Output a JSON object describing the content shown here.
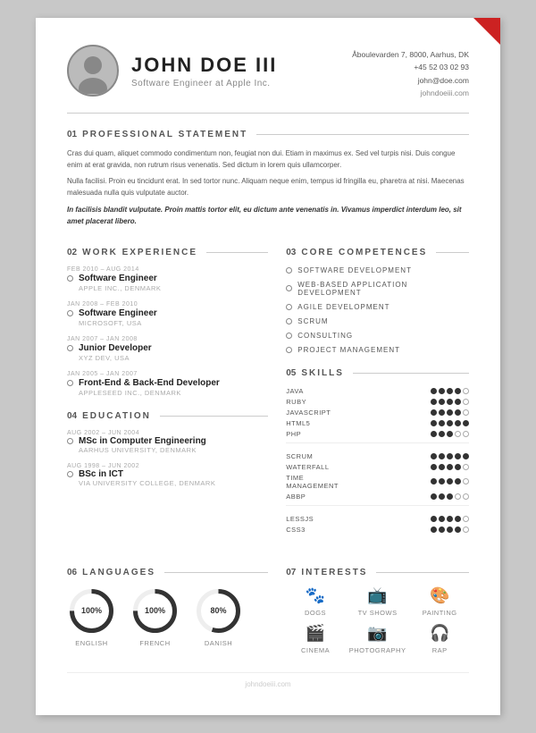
{
  "header": {
    "name": "JOHN DOE III",
    "subtitle": "Software Engineer at Apple Inc.",
    "address": "Åboulevarden 7, 8000, Aarhus, DK",
    "phone": "+45 52 03 02 93",
    "email": "john@doe.com",
    "website": "johndoeiii.com"
  },
  "sections": {
    "professional_statement": {
      "num": "01",
      "label": "PROFESSIONAL STATEMENT",
      "paragraphs": [
        "Cras dui quam, aliquet commodo condimentum non, feugiat non dui. Etiam in maximus ex. Sed vel turpis nisi. Duis congue enim at erat gravida, non rutrum risus venenatis. Sed dictum in lorem quis ullamcorper.",
        "Nulla facilisi. Proin eu tincidunt erat. In sed tortor nunc. Aliquam neque enim, tempus id fringilla eu, pharetra at nisi. Maecenas malesuada nulla quis vulputate auctor.",
        "In facilisis blandit vulputate. Proin mattis tortor elit, eu dictum ante venenatis in. Vivamus imperdict interdum leo, sit amet placerat libero."
      ]
    },
    "work_experience": {
      "num": "02",
      "label": "WORK EXPERIENCE",
      "jobs": [
        {
          "date": "FEB 2010 – AUG 2014",
          "title": "Software Engineer",
          "company": "APPLE INC., DENMARK"
        },
        {
          "date": "JAN 2008 – FEB 2010",
          "title": "Software Engineer",
          "company": "MICROSOFT, USA"
        },
        {
          "date": "JAN 2007 – JAN 2008",
          "title": "Junior Developer",
          "company": "XYZ DEV, USA"
        },
        {
          "date": "JAN 2005 – JAN 2007",
          "title": "Front-End & Back-End Developer",
          "company": "APPLESEED INC., DENMARK"
        }
      ]
    },
    "education": {
      "num": "04",
      "label": "EDUCATION",
      "items": [
        {
          "date": "AUG 2002 – JUN 2004",
          "title": "MSc in Computer Engineering",
          "school": "AARHUS UNIVERSITY, DENMARK"
        },
        {
          "date": "AUG 1998 – JUN 2002",
          "title": "BSc in ICT",
          "school": "VIA UNIVERSITY COLLEGE, DENMARK"
        }
      ]
    },
    "core_competences": {
      "num": "03",
      "label": "CORE COMPETENCES",
      "items": [
        "SOFTWARE DEVELOPMENT",
        "WEB-BASED APPLICATION DEVELOPMENT",
        "AGILE DEVELOPMENT",
        "SCRUM",
        "CONSULTING",
        "PROJECT MANAGEMENT"
      ]
    },
    "skills": {
      "num": "05",
      "label": "SKILLS",
      "groups": [
        {
          "items": [
            {
              "name": "JAVA",
              "filled": 4,
              "empty": 1
            },
            {
              "name": "RUBY",
              "filled": 4,
              "empty": 1
            },
            {
              "name": "JAVASCRIPT",
              "filled": 4,
              "empty": 1
            },
            {
              "name": "HTML5",
              "filled": 5,
              "empty": 0
            },
            {
              "name": "PHP",
              "filled": 3,
              "empty": 2
            }
          ]
        },
        {
          "items": [
            {
              "name": "SCRUM",
              "filled": 5,
              "empty": 0
            },
            {
              "name": "WATERFALL",
              "filled": 4,
              "empty": 1
            },
            {
              "name": "TIME MANAGEMENT",
              "filled": 4,
              "empty": 1
            },
            {
              "name": "ABBP",
              "filled": 3,
              "empty": 2
            }
          ]
        },
        {
          "items": [
            {
              "name": "LESSJS",
              "filled": 4,
              "empty": 1
            },
            {
              "name": "CSS3",
              "filled": 4,
              "empty": 1
            }
          ]
        }
      ]
    },
    "languages": {
      "num": "06",
      "label": "LANGUAGES",
      "items": [
        {
          "name": "ENGLISH",
          "pct": 100
        },
        {
          "name": "FRENCH",
          "pct": 100
        },
        {
          "name": "DANISH",
          "pct": 80
        }
      ]
    },
    "interests": {
      "num": "07",
      "label": "INTERESTS",
      "items": [
        {
          "name": "DOGS",
          "icon": "🐾"
        },
        {
          "name": "TV SHOWS",
          "icon": "📺"
        },
        {
          "name": "PAINTING",
          "icon": "🎨"
        },
        {
          "name": "CINEMA",
          "icon": "🎬"
        },
        {
          "name": "PHOTOGRAPHY",
          "icon": "📷"
        },
        {
          "name": "RAP",
          "icon": "🎧"
        }
      ]
    }
  },
  "footer": {
    "text": "johndoeiii.com"
  }
}
